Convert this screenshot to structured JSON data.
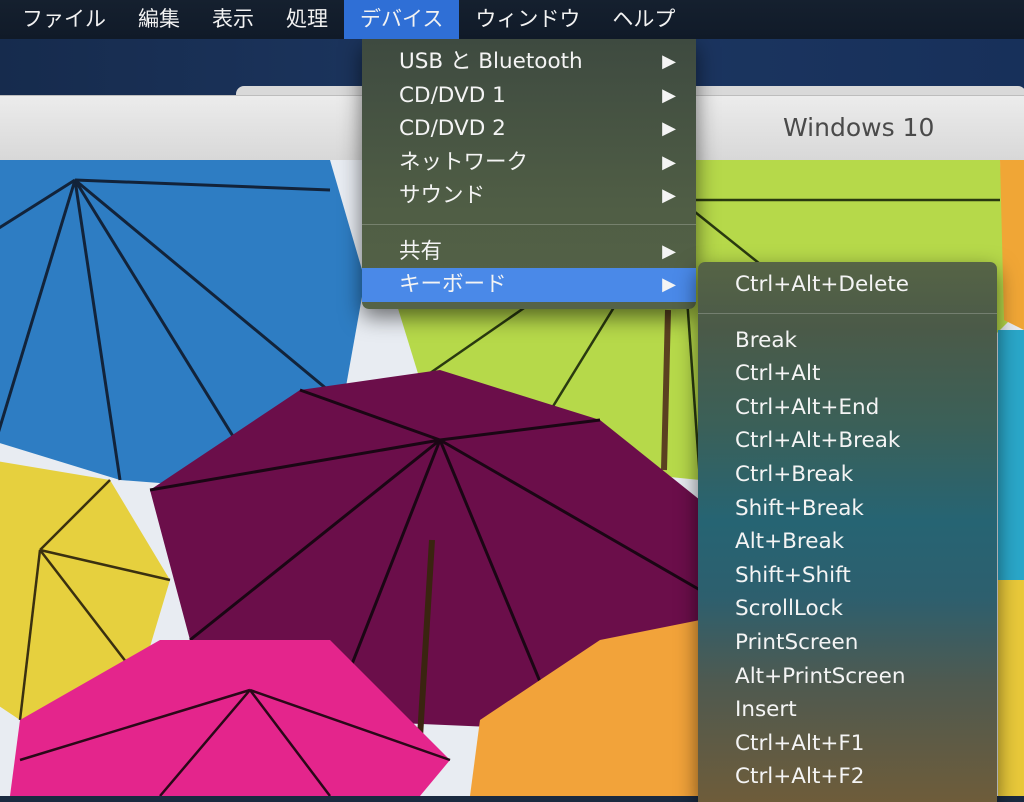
{
  "menubar": {
    "items": [
      {
        "label": "ファイル"
      },
      {
        "label": "編集"
      },
      {
        "label": "表示"
      },
      {
        "label": "処理"
      },
      {
        "label": "デバイス",
        "active": true
      },
      {
        "label": "ウィンドウ"
      },
      {
        "label": "ヘルプ"
      }
    ]
  },
  "window": {
    "title": "Windows 10"
  },
  "devices_menu": {
    "group1": [
      {
        "label": "USB と Bluetooth",
        "arrow": "▶"
      },
      {
        "label": "CD/DVD 1",
        "arrow": "▶"
      },
      {
        "label": "CD/DVD 2",
        "arrow": "▶"
      },
      {
        "label": "ネットワーク",
        "arrow": "▶"
      },
      {
        "label": "サウンド",
        "arrow": "▶"
      }
    ],
    "group2": [
      {
        "label": "共有",
        "arrow": "▶"
      },
      {
        "label": "キーボード",
        "arrow": "▶",
        "highlighted": true
      }
    ]
  },
  "keyboard_submenu": {
    "top": "Ctrl+Alt+Delete",
    "items": [
      "Break",
      "Ctrl+Alt",
      "Ctrl+Alt+End",
      "Ctrl+Alt+Break",
      "Ctrl+Break",
      "Shift+Break",
      "Alt+Break",
      "Shift+Shift",
      "ScrollLock",
      "PrintScreen",
      "Alt+PrintScreen",
      "Insert",
      "Ctrl+Alt+F1",
      "Ctrl+Alt+F2"
    ]
  },
  "colors": {
    "menubar_bg": "#101a28",
    "active_menu": "#2f6fd6",
    "highlight": "#4a89e8"
  }
}
